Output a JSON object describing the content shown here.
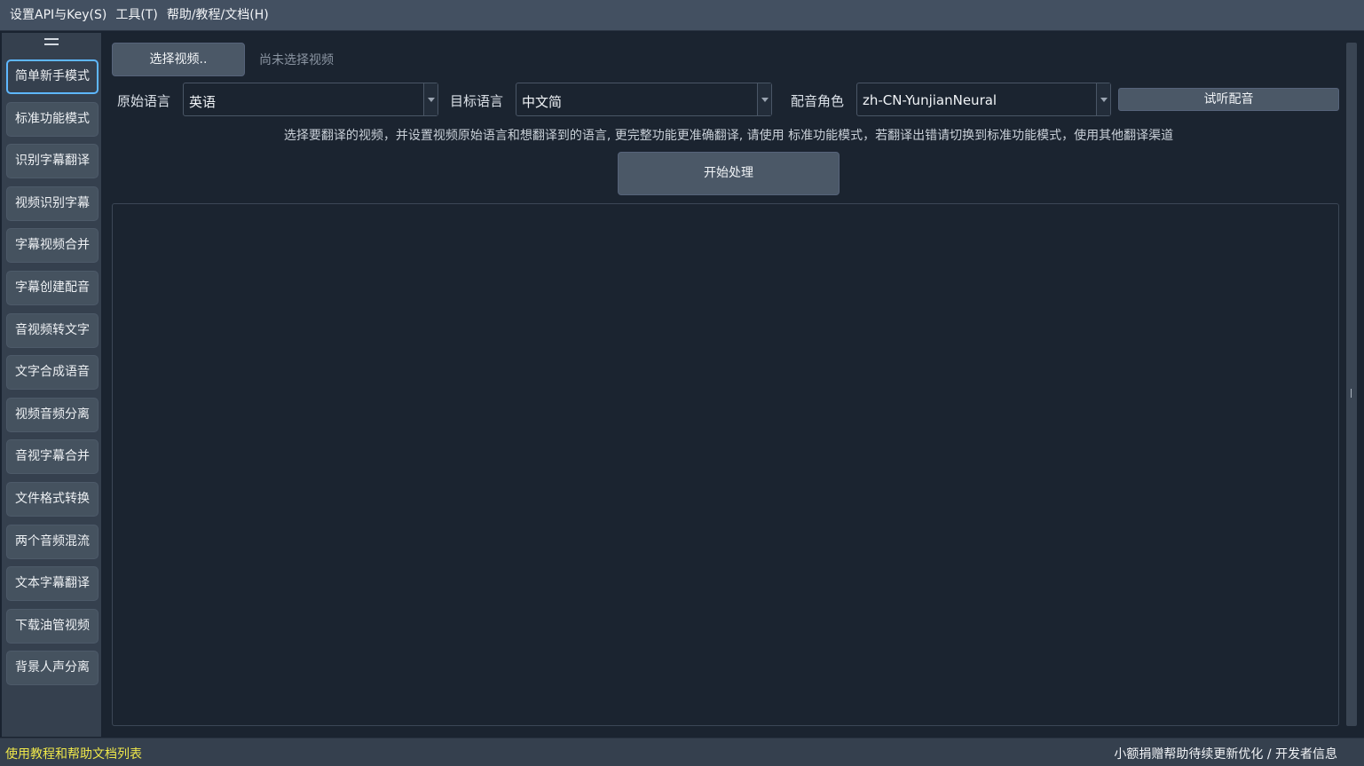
{
  "menubar": {
    "items": [
      "设置API与Key(S)",
      "工具(T)",
      "帮助/教程/文档(H)"
    ]
  },
  "sidebar": {
    "items": [
      {
        "label": "简单新手模式",
        "active": true
      },
      {
        "label": "标准功能模式"
      },
      {
        "label": "识别字幕翻译"
      },
      {
        "label": "视频识别字幕"
      },
      {
        "label": "字幕视频合并"
      },
      {
        "label": "字幕创建配音"
      },
      {
        "label": "音视频转文字"
      },
      {
        "label": "文字合成语音"
      },
      {
        "label": "视频音频分离"
      },
      {
        "label": "音视字幕合并"
      },
      {
        "label": "文件格式转换"
      },
      {
        "label": "两个音频混流"
      },
      {
        "label": "文本字幕翻译"
      },
      {
        "label": "下载油管视频"
      },
      {
        "label": "背景人声分离"
      }
    ]
  },
  "main": {
    "select_video_label": "选择视频..",
    "no_video_text": "尚未选择视频",
    "source_language": {
      "label": "原始语言",
      "value": "英语"
    },
    "target_language": {
      "label": "目标语言",
      "value": "中文简"
    },
    "voice_role": {
      "label": "配音角色",
      "value": "zh-CN-YunjianNeural"
    },
    "preview_voice_label": "试听配音",
    "hint": "选择要翻译的视频，并设置视频原始语言和想翻译到的语言, 更完整功能更准确翻译, 请使用 标准功能模式，若翻译出错请切换到标准功能模式，使用其他翻译渠道",
    "start_label": "开始处理"
  },
  "statusbar": {
    "left_link": "使用教程和帮助文档列表",
    "right_link": "小额捐赠帮助待续更新优化 / 开发者信息"
  },
  "colors": {
    "accent": "#5eb7ff",
    "status_link": "#f0e84a",
    "background": "#1b2430"
  }
}
